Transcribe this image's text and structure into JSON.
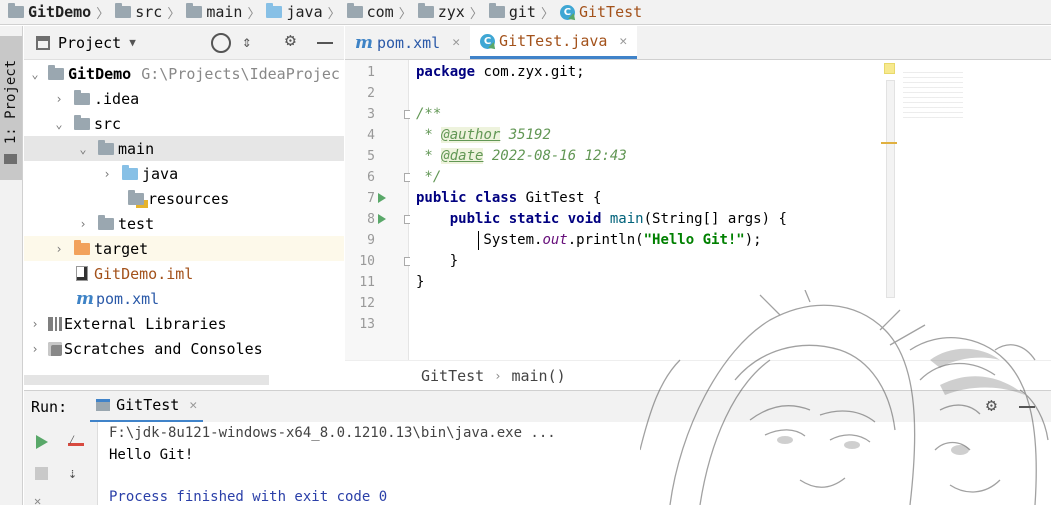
{
  "navbar": {
    "items": [
      "GitDemo",
      "src",
      "main",
      "java",
      "com",
      "zyx",
      "git",
      "GitTest"
    ]
  },
  "left_stripe": {
    "project_tab": "1: Project"
  },
  "project_panel": {
    "title": "Project",
    "tree": [
      {
        "label": "GitDemo",
        "suffix": "G:\\Projects\\IdeaProjec"
      },
      {
        "label": ".idea"
      },
      {
        "label": "src"
      },
      {
        "label": "main"
      },
      {
        "label": "java"
      },
      {
        "label": "resources"
      },
      {
        "label": "test"
      },
      {
        "label": "target"
      },
      {
        "label": "GitDemo.iml"
      },
      {
        "label": "pom.xml"
      },
      {
        "label": "External Libraries"
      },
      {
        "label": "Scratches and Consoles"
      }
    ]
  },
  "editor": {
    "tabs": [
      {
        "label": "pom.xml"
      },
      {
        "label": "GitTest.java"
      }
    ],
    "line_numbers": [
      "1",
      "2",
      "3",
      "4",
      "5",
      "6",
      "7",
      "8",
      "9",
      "10",
      "11",
      "12",
      "13"
    ],
    "code": {
      "l1_kw": "package",
      "l1_rest": " com.zyx.git;",
      "l3": "/**",
      "l4_star": " * ",
      "l4_tag": "@author",
      "l4_val": " 35192",
      "l5_star": " * ",
      "l5_tag": "@date",
      "l5_val": " 2022-08-16 12:43",
      "l6": " */",
      "l7_kw": "public class",
      "l7_rest": " GitTest {",
      "l8_kw": "    public static void",
      "l8_fn": " main",
      "l8_rest": "(String[] args) {",
      "l9_a": "        System.",
      "l9_out": "out",
      "l9_b": ".println(",
      "l9_str": "\"Hello Git!\"",
      "l9_c": ");",
      "l10": "    }",
      "l11": "}"
    },
    "breadcrumb": {
      "class": "GitTest",
      "method": "main()"
    }
  },
  "run_panel": {
    "label": "Run:",
    "tab": "GitTest",
    "console": [
      "F:\\jdk-8u121-windows-x64_8.0.1210.13\\bin\\java.exe ...",
      "Hello Git!",
      "",
      "Process finished with exit code 0"
    ]
  },
  "colors": {
    "accent": "#4083c9",
    "keyword": "#000080",
    "string": "#008000",
    "comment": "#629755",
    "run_green": "#59a869"
  }
}
